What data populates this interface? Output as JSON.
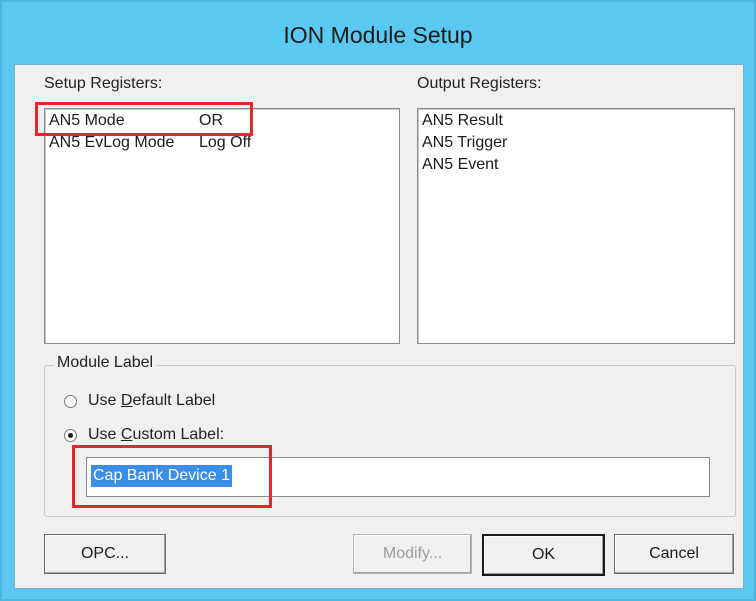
{
  "window": {
    "title": "ION Module Setup"
  },
  "setup_registers": {
    "label": "Setup Registers:",
    "rows": [
      {
        "name": "AN5 Mode",
        "value": "OR"
      },
      {
        "name": "AN5 EvLog Mode",
        "value": "Log Off"
      }
    ]
  },
  "output_registers": {
    "label": "Output Registers:",
    "items": [
      "AN5 Result",
      "AN5 Trigger",
      "AN5 Event"
    ]
  },
  "module_label": {
    "group_title": "Module Label",
    "default_option": {
      "before": "Use ",
      "accel": "D",
      "after": "efault Label",
      "selected": false
    },
    "custom_option": {
      "before": "Use ",
      "accel": "C",
      "after": "ustom Label:",
      "selected": true
    },
    "custom_value": "Cap Bank Device 1"
  },
  "buttons": {
    "opc": "OPC...",
    "modify": "Modify...",
    "ok": "OK",
    "cancel": "Cancel"
  },
  "colors": {
    "title_bar": "#5ac8f0",
    "highlight_box": "#e8262a",
    "selection": "#3a8ee6"
  }
}
